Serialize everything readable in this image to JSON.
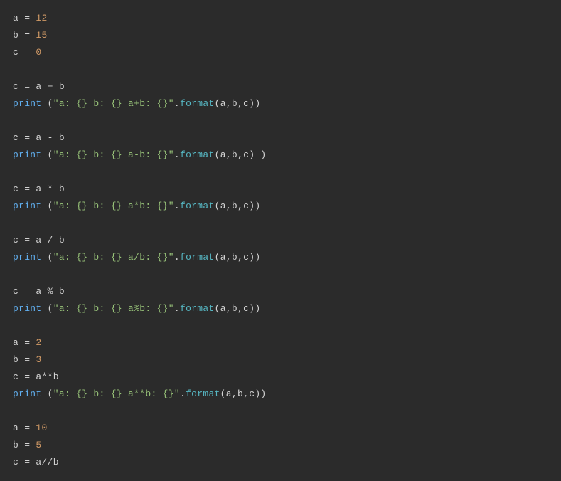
{
  "code": {
    "lines": [
      [
        {
          "c": "va",
          "t": "a "
        },
        {
          "c": "op",
          "t": "= "
        },
        {
          "c": "nu",
          "t": "12"
        }
      ],
      [
        {
          "c": "va",
          "t": "b "
        },
        {
          "c": "op",
          "t": "= "
        },
        {
          "c": "nu",
          "t": "15"
        }
      ],
      [
        {
          "c": "va",
          "t": "c "
        },
        {
          "c": "op",
          "t": "= "
        },
        {
          "c": "nu",
          "t": "0"
        }
      ],
      [],
      [
        {
          "c": "va",
          "t": "c "
        },
        {
          "c": "op",
          "t": "= "
        },
        {
          "c": "va",
          "t": "a "
        },
        {
          "c": "op",
          "t": "+ "
        },
        {
          "c": "va",
          "t": "b"
        }
      ],
      [
        {
          "c": "fn",
          "t": "print "
        },
        {
          "c": "op",
          "t": "("
        },
        {
          "c": "st",
          "t": "\"a: {} b: {} a+b: {}\""
        },
        {
          "c": "op",
          "t": "."
        },
        {
          "c": "mt",
          "t": "format"
        },
        {
          "c": "op",
          "t": "("
        },
        {
          "c": "va",
          "t": "a"
        },
        {
          "c": "op",
          "t": ","
        },
        {
          "c": "va",
          "t": "b"
        },
        {
          "c": "op",
          "t": ","
        },
        {
          "c": "va",
          "t": "c"
        },
        {
          "c": "op",
          "t": "))"
        }
      ],
      [],
      [
        {
          "c": "va",
          "t": "c "
        },
        {
          "c": "op",
          "t": "= "
        },
        {
          "c": "va",
          "t": "a "
        },
        {
          "c": "op",
          "t": "- "
        },
        {
          "c": "va",
          "t": "b"
        }
      ],
      [
        {
          "c": "fn",
          "t": "print "
        },
        {
          "c": "op",
          "t": "("
        },
        {
          "c": "st",
          "t": "\"a: {} b: {} a-b: {}\""
        },
        {
          "c": "op",
          "t": "."
        },
        {
          "c": "mt",
          "t": "format"
        },
        {
          "c": "op",
          "t": "("
        },
        {
          "c": "va",
          "t": "a"
        },
        {
          "c": "op",
          "t": ","
        },
        {
          "c": "va",
          "t": "b"
        },
        {
          "c": "op",
          "t": ","
        },
        {
          "c": "va",
          "t": "c"
        },
        {
          "c": "op",
          "t": ") )"
        }
      ],
      [],
      [
        {
          "c": "va",
          "t": "c "
        },
        {
          "c": "op",
          "t": "= "
        },
        {
          "c": "va",
          "t": "a "
        },
        {
          "c": "op",
          "t": "* "
        },
        {
          "c": "va",
          "t": "b"
        }
      ],
      [
        {
          "c": "fn",
          "t": "print "
        },
        {
          "c": "op",
          "t": "("
        },
        {
          "c": "st",
          "t": "\"a: {} b: {} a*b: {}\""
        },
        {
          "c": "op",
          "t": "."
        },
        {
          "c": "mt",
          "t": "format"
        },
        {
          "c": "op",
          "t": "("
        },
        {
          "c": "va",
          "t": "a"
        },
        {
          "c": "op",
          "t": ","
        },
        {
          "c": "va",
          "t": "b"
        },
        {
          "c": "op",
          "t": ","
        },
        {
          "c": "va",
          "t": "c"
        },
        {
          "c": "op",
          "t": "))"
        }
      ],
      [],
      [
        {
          "c": "va",
          "t": "c "
        },
        {
          "c": "op",
          "t": "= "
        },
        {
          "c": "va",
          "t": "a "
        },
        {
          "c": "op",
          "t": "/ "
        },
        {
          "c": "va",
          "t": "b"
        }
      ],
      [
        {
          "c": "fn",
          "t": "print "
        },
        {
          "c": "op",
          "t": "("
        },
        {
          "c": "st",
          "t": "\"a: {} b: {} a/b: {}\""
        },
        {
          "c": "op",
          "t": "."
        },
        {
          "c": "mt",
          "t": "format"
        },
        {
          "c": "op",
          "t": "("
        },
        {
          "c": "va",
          "t": "a"
        },
        {
          "c": "op",
          "t": ","
        },
        {
          "c": "va",
          "t": "b"
        },
        {
          "c": "op",
          "t": ","
        },
        {
          "c": "va",
          "t": "c"
        },
        {
          "c": "op",
          "t": "))"
        }
      ],
      [],
      [
        {
          "c": "va",
          "t": "c "
        },
        {
          "c": "op",
          "t": "= "
        },
        {
          "c": "va",
          "t": "a "
        },
        {
          "c": "op",
          "t": "% "
        },
        {
          "c": "va",
          "t": "b"
        }
      ],
      [
        {
          "c": "fn",
          "t": "print "
        },
        {
          "c": "op",
          "t": "("
        },
        {
          "c": "st",
          "t": "\"a: {} b: {} a%b: {}\""
        },
        {
          "c": "op",
          "t": "."
        },
        {
          "c": "mt",
          "t": "format"
        },
        {
          "c": "op",
          "t": "("
        },
        {
          "c": "va",
          "t": "a"
        },
        {
          "c": "op",
          "t": ","
        },
        {
          "c": "va",
          "t": "b"
        },
        {
          "c": "op",
          "t": ","
        },
        {
          "c": "va",
          "t": "c"
        },
        {
          "c": "op",
          "t": "))"
        }
      ],
      [],
      [
        {
          "c": "va",
          "t": "a "
        },
        {
          "c": "op",
          "t": "= "
        },
        {
          "c": "nu",
          "t": "2"
        }
      ],
      [
        {
          "c": "va",
          "t": "b "
        },
        {
          "c": "op",
          "t": "= "
        },
        {
          "c": "nu",
          "t": "3"
        }
      ],
      [
        {
          "c": "va",
          "t": "c "
        },
        {
          "c": "op",
          "t": "= "
        },
        {
          "c": "va",
          "t": "a"
        },
        {
          "c": "op",
          "t": "**"
        },
        {
          "c": "va",
          "t": "b"
        }
      ],
      [
        {
          "c": "fn",
          "t": "print "
        },
        {
          "c": "op",
          "t": "("
        },
        {
          "c": "st",
          "t": "\"a: {} b: {} a**b: {}\""
        },
        {
          "c": "op",
          "t": "."
        },
        {
          "c": "mt",
          "t": "format"
        },
        {
          "c": "op",
          "t": "("
        },
        {
          "c": "va",
          "t": "a"
        },
        {
          "c": "op",
          "t": ","
        },
        {
          "c": "va",
          "t": "b"
        },
        {
          "c": "op",
          "t": ","
        },
        {
          "c": "va",
          "t": "c"
        },
        {
          "c": "op",
          "t": "))"
        }
      ],
      [],
      [
        {
          "c": "va",
          "t": "a "
        },
        {
          "c": "op",
          "t": "= "
        },
        {
          "c": "nu",
          "t": "10"
        }
      ],
      [
        {
          "c": "va",
          "t": "b "
        },
        {
          "c": "op",
          "t": "= "
        },
        {
          "c": "nu",
          "t": "5"
        }
      ],
      [
        {
          "c": "va",
          "t": "c "
        },
        {
          "c": "op",
          "t": "= "
        },
        {
          "c": "va",
          "t": "a"
        },
        {
          "c": "op",
          "t": "//"
        },
        {
          "c": "va",
          "t": "b"
        }
      ]
    ]
  }
}
